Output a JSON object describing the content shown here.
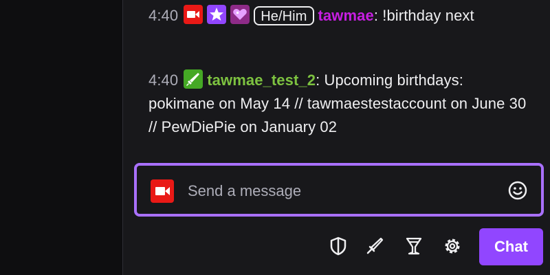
{
  "messages": [
    {
      "timestamp": "4:40",
      "badges": [
        "camera-badge",
        "star-badge",
        "heart-badge"
      ],
      "pronoun": "He/Him",
      "username": "tawmae",
      "username_color": "#c71ee2",
      "text": ": !birthday next"
    },
    {
      "timestamp": "4:40",
      "badges": [
        "sword-badge"
      ],
      "username": "tawmae_test_2",
      "username_color": "#7dc240",
      "text": ": Upcoming birthdays: pokimane on May 14 // tawmaestestaccount on June 30 // PewDiePie on January 02"
    }
  ],
  "input": {
    "placeholder": "Send a message",
    "value": ""
  },
  "toolbar": {
    "icons": [
      "shield-icon",
      "sword-icon",
      "goblet-icon",
      "gear-icon"
    ],
    "chat_label": "Chat"
  },
  "colors": {
    "accent": "#9146ff",
    "input_border": "#a970ff",
    "background": "#18181b"
  }
}
